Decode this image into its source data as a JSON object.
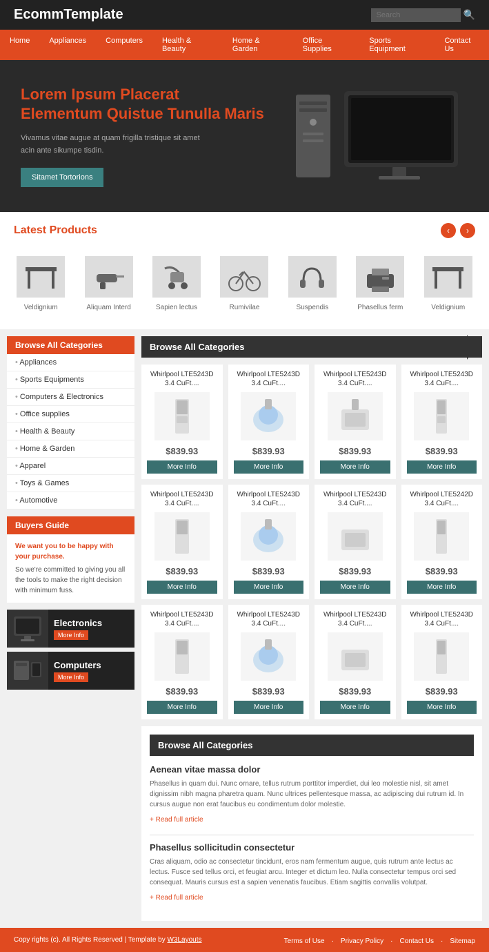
{
  "header": {
    "logo": "EcommTemplate",
    "search_placeholder": "Search"
  },
  "nav": {
    "items": [
      {
        "label": "Home",
        "url": "#"
      },
      {
        "label": "Appliances",
        "url": "#"
      },
      {
        "label": "Computers",
        "url": "#"
      },
      {
        "label": "Health & Beauty",
        "url": "#"
      },
      {
        "label": "Home & Garden",
        "url": "#"
      },
      {
        "label": "Office Supplies",
        "url": "#"
      },
      {
        "label": "Sports Equipment",
        "url": "#"
      },
      {
        "label": "Contact Us",
        "url": "#"
      }
    ]
  },
  "hero": {
    "title_line1": "Lorem Ipsum Placerat",
    "title_line2": "Elementum Quistue Tunulla Maris",
    "description": "Vivamus vitae augue at quam frigilla tristique sit amet acin ante sikumpe tisdin.",
    "button_label": "Sitamet Tortorions"
  },
  "latest_products": {
    "section_title": "Latest Products",
    "items": [
      {
        "label": "Veldignium"
      },
      {
        "label": "Aliquam Interd"
      },
      {
        "label": "Sapien lectus"
      },
      {
        "label": "Rumivilae"
      },
      {
        "label": "Suspendis"
      },
      {
        "label": "Phasellus ferm"
      },
      {
        "label": "Veldignium"
      }
    ]
  },
  "sidebar": {
    "browse_label": "Browse All Categories",
    "categories": [
      "Appliances",
      "Sports Equipments",
      "Computers & Electronics",
      "Office supplies",
      "Health & Beauty",
      "Home & Garden",
      "Apparel",
      "Toys & Games",
      "Automotive"
    ],
    "buyers_guide_label": "Buyers Guide",
    "buyers_text_highlight": "We want you to be happy with your purchase.",
    "buyers_text_body": "So we're committed to giving you all the tools to make the right decision with minimum fuss.",
    "promos": [
      {
        "title": "Electronics",
        "btn": "More Info"
      },
      {
        "title": "Computers",
        "btn": "More Info"
      }
    ]
  },
  "product_grid": {
    "section_title": "Browse All Categories",
    "products": [
      {
        "title": "Whirlpool LTE5243D 3.4 CuFt....",
        "price": "$839.93",
        "btn": "More Info"
      },
      {
        "title": "Whirlpool LTE5243D 3.4 CuFt....",
        "price": "$839.93",
        "btn": "More Info"
      },
      {
        "title": "Whirlpool LTE5243D 3.4 CuFt....",
        "price": "$839.93",
        "btn": "More Info"
      },
      {
        "title": "Whirlpool LTE5243D 3.4 CuFt....",
        "price": "$839.93",
        "btn": "More Info"
      },
      {
        "title": "Whirlpool LTE5243D 3.4 CuFt....",
        "price": "$839.93",
        "btn": "More Info"
      },
      {
        "title": "Whirlpool LTE5243D 3.4 CuFt....",
        "price": "$839.93",
        "btn": "More Info"
      },
      {
        "title": "Whirlpool LTE5243D 3.4 CuFt....",
        "price": "$839.93",
        "btn": "More Info"
      },
      {
        "title": "Whirlpool LTE5242D 3.4 CuFt....",
        "price": "$839.93",
        "btn": "More Info"
      },
      {
        "title": "Whirlpool LTE5243D 3.4 CuFt....",
        "price": "$839.93",
        "btn": "More Info"
      },
      {
        "title": "Whirlpool LTE5243D 3.4 CuFt....",
        "price": "$839.93",
        "btn": "More Info"
      },
      {
        "title": "Whirlpool LTE5243D 3.4 CuFt....",
        "price": "$839.93",
        "btn": "More Info"
      },
      {
        "title": "Whirlpool LTE5243D 3.4 CuFt....",
        "price": "$839.93",
        "btn": "More Info"
      }
    ]
  },
  "blog": {
    "section_title": "Browse All Categories",
    "articles": [
      {
        "title": "Aenean vitae massa dolor",
        "body": "Phasellus in quam dui. Nunc ornare, tellus rutrum porttitor imperdiet, dui leo molestie nisl, sit amet dignissim nibh magna pharetra quam. Nunc ultrices pellentesque massa, ac adipiscing dui rutrum id. In cursus augue non erat faucibus eu condimentum dolor molestie.",
        "read_more": "+ Read full article"
      },
      {
        "title": "Phasellus sollicitudin consectetur",
        "body": "Cras aliquam, odio ac consectetur tincidunt, eros nam fermentum augue, quis rutrum ante lectus ac lectus. Fusce sed tellus orci, et feugiat arcu. Integer et dictum leo. Nulla consectetur tempus orci sed consequat. Mauris cursus est a sapien venenatis faucibus. Etiam sagittis convallis volutpat.",
        "read_more": "+ Read full article"
      }
    ]
  },
  "footer": {
    "copy": "Copy rights (c). All Rights Reserved | Template by W3Layouts",
    "links": [
      "Terms of Use",
      "Privacy Policy",
      "Contact Us",
      "Sitemap"
    ]
  }
}
